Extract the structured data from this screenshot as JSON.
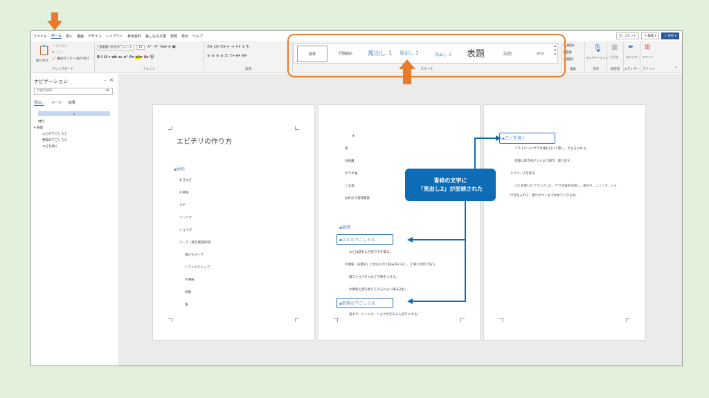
{
  "menu": {
    "tabs": [
      "ファイル",
      "ホーム",
      "挿入",
      "描画",
      "デザイン",
      "レイアウト",
      "参考資料",
      "差し込み文書",
      "校閲",
      "表示",
      "ヘルプ"
    ],
    "active_index": 1,
    "comment": "コメント",
    "edit": "編集",
    "share": "共有"
  },
  "ribbon": {
    "clipboard": {
      "label": "クリップボード",
      "paste": "貼り付け",
      "cut": "切り取り",
      "copy": "コピー",
      "format_painter": "書式のコピー/貼り付け"
    },
    "font": {
      "label": "フォント",
      "name": "游明朝 (本文のフォント",
      "size": "12"
    },
    "paragraph": {
      "label": "段落"
    },
    "styles": {
      "label": "スタイル",
      "items": [
        "標準",
        "行間詰め",
        "見出し 1",
        "見出し 2",
        "見出し 3",
        "表題",
        "副題",
        "斜体"
      ]
    },
    "editing": {
      "label": "編集",
      "find": "検索",
      "replace": "置換",
      "select": "選択"
    },
    "voice": {
      "label": "音声",
      "dictate": "ディクテーション"
    },
    "sensitivity": {
      "label": "秘密度",
      "btn": "秘密度"
    },
    "editor": {
      "label": "エディター",
      "btn": "エディター"
    },
    "addins": {
      "label": "アドイン",
      "btn": "アドイン"
    }
  },
  "nav": {
    "title": "ナビゲーション",
    "search_placeholder": "文書の検索",
    "tabs": [
      "見出し",
      "ページ",
      "結果"
    ],
    "highlight": "a",
    "items": [
      "材料",
      "調理",
      "エビの下ごしらえ",
      "野菜の下ごしらえ",
      "エビを焼く"
    ]
  },
  "pages": {
    "p1": {
      "title": "エビチリの作り方",
      "heading": "材料",
      "items": [
        "むきエビ",
        "片栗粉",
        "ネギ",
        "ニンニク",
        "ショウガ",
        "ソース（他を使調味料）",
        "鶏がらスープ",
        "トマトケチャップ",
        "片栗粉",
        "砂糖",
        "塩"
      ]
    },
    "p2": {
      "top_items": [
        "水",
        "酒",
        "豆板醤",
        "サラダ油",
        "ごま油",
        "お好みで香味野菜"
      ],
      "heading_main": "調理",
      "heading_a": "エビの下ごしらえ",
      "items_a": [
        "エビは殻をむき背ワタを取る。",
        "片栗粉（分量外）と水を入れて揉み洗いをし、丁寧に流水で洗う。",
        "塩コショウを入れて下味をつける。",
        "片栗粉と酒を加えてさらによく揉み込む。"
      ],
      "heading_b": "野菜の下ごしらえ",
      "items_b": [
        "長ネギ、ニンニク、ショウガをみじん切りにする。"
      ]
    },
    "p3": {
      "heading": "エビを焼く",
      "items": [
        "フライパンにサラダ油を引いて熱し、エビを入れる。",
        "両面に焼き色がつくまで焼き、取り出す。",
        "チリソースを作る",
        "エビを焼いたフライパンに、サラダ油を追加し、長ネギ、ニンニク、ショ",
        "ウガを入れて、香りがつくまで炒めていきます。"
      ]
    }
  },
  "annotation": {
    "line1": "青枠の文字に",
    "line2": "「見出し2」が反映された"
  },
  "colors": {
    "accent_orange": "#e87b2a",
    "callout_blue": "#0e6bb5",
    "heading_blue": "#5b8ec7"
  }
}
